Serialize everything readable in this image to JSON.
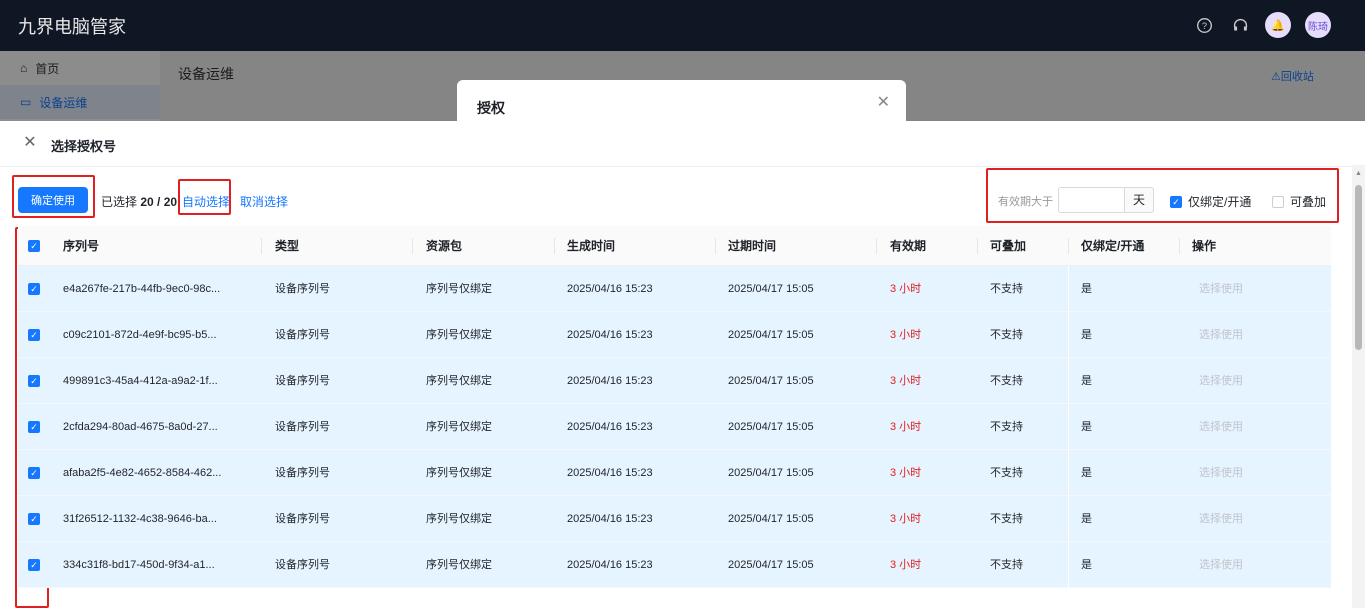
{
  "app": {
    "brand": "九界电脑管家",
    "avatar_text": "陈琦",
    "sidebar": [
      {
        "label": "首页",
        "icon": "home-icon"
      },
      {
        "label": "设备运维",
        "icon": "monitor-icon"
      }
    ],
    "content_title": "设备运维",
    "recycle_link": "回收站",
    "dialog_title": "授权"
  },
  "drawer": {
    "title": "选择授权号",
    "confirm_button": "确定使用",
    "selected_prefix": "已选择",
    "selected_count": "20 / 20",
    "auto_select": "自动选择",
    "cancel_select": "取消选择",
    "filter_label": "有效期大于",
    "days_value": "",
    "days_suffix": "天",
    "only_bind_label": "仅绑定/开通",
    "only_bind_checked": true,
    "stackable_label": "可叠加",
    "stackable_checked": false
  },
  "table": {
    "columns": [
      "序列号",
      "类型",
      "资源包",
      "生成时间",
      "过期时间",
      "有效期",
      "可叠加",
      "仅绑定/开通",
      "操作"
    ],
    "all_checked": true,
    "rows": [
      {
        "serial": "e4a267fe-217b-44fb-9ec0-98c...",
        "type": "设备序列号",
        "package": "序列号仅绑定",
        "created": "2025/04/16 15:23",
        "expires": "2025/04/17 15:05",
        "validity": "3 小时",
        "stackable": "不支持",
        "bind_only": "是",
        "action": "选择使用",
        "checked": true
      },
      {
        "serial": "c09c2101-872d-4e9f-bc95-b5...",
        "type": "设备序列号",
        "package": "序列号仅绑定",
        "created": "2025/04/16 15:23",
        "expires": "2025/04/17 15:05",
        "validity": "3 小时",
        "stackable": "不支持",
        "bind_only": "是",
        "action": "选择使用",
        "checked": true
      },
      {
        "serial": "499891c3-45a4-412a-a9a2-1f...",
        "type": "设备序列号",
        "package": "序列号仅绑定",
        "created": "2025/04/16 15:23",
        "expires": "2025/04/17 15:05",
        "validity": "3 小时",
        "stackable": "不支持",
        "bind_only": "是",
        "action": "选择使用",
        "checked": true
      },
      {
        "serial": "2cfda294-80ad-4675-8a0d-27...",
        "type": "设备序列号",
        "package": "序列号仅绑定",
        "created": "2025/04/16 15:23",
        "expires": "2025/04/17 15:05",
        "validity": "3 小时",
        "stackable": "不支持",
        "bind_only": "是",
        "action": "选择使用",
        "checked": true
      },
      {
        "serial": "afaba2f5-4e82-4652-8584-462...",
        "type": "设备序列号",
        "package": "序列号仅绑定",
        "created": "2025/04/16 15:23",
        "expires": "2025/04/17 15:05",
        "validity": "3 小时",
        "stackable": "不支持",
        "bind_only": "是",
        "action": "选择使用",
        "checked": true
      },
      {
        "serial": "31f26512-1132-4c38-9646-ba...",
        "type": "设备序列号",
        "package": "序列号仅绑定",
        "created": "2025/04/16 15:23",
        "expires": "2025/04/17 15:05",
        "validity": "3 小时",
        "stackable": "不支持",
        "bind_only": "是",
        "action": "选择使用",
        "checked": true
      },
      {
        "serial": "334c31f8-bd17-450d-9f34-a1...",
        "type": "设备序列号",
        "package": "序列号仅绑定",
        "created": "2025/04/16 15:23",
        "expires": "2025/04/17 15:05",
        "validity": "3 小时",
        "stackable": "不支持",
        "bind_only": "是",
        "action": "选择使用",
        "checked": true
      }
    ]
  },
  "colors": {
    "primary": "#1677ff",
    "highlight_box": "#e02020",
    "validity_text": "#e02020",
    "row_selected_bg": "#e6f4ff"
  }
}
